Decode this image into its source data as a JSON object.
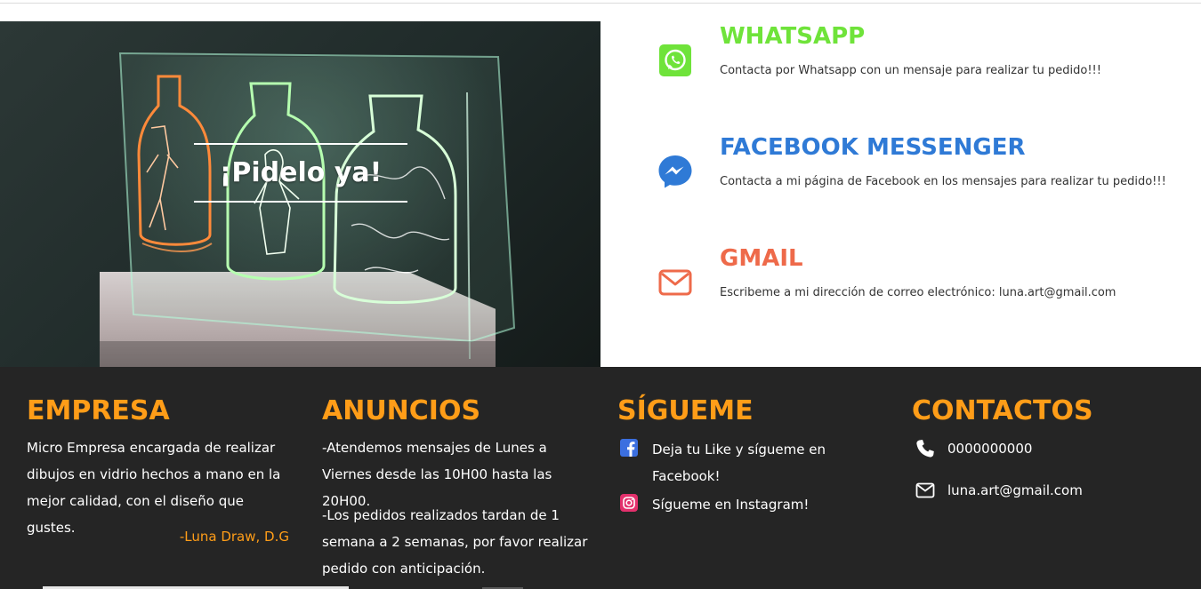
{
  "hero": {
    "title": "¡Pidelo ya!"
  },
  "methods": {
    "whatsapp": {
      "title": "WHATSAPP",
      "description": "Contacta por Whatsapp con un mensaje para realizar tu pedido!!!",
      "color": "#6fe33a",
      "icon": "whatsapp-icon"
    },
    "messenger": {
      "title": "FACEBOOK MESSENGER",
      "description": "Contacta a mi página de Facebook en los mensajes para realizar tu pedido!!!",
      "color": "#2f7ad6",
      "icon": "messenger-icon"
    },
    "gmail": {
      "title": "GMAIL",
      "description": "Escribeme a mi dirección de correo electrónico: luna.art@gmail.com",
      "color": "#ee6a4a",
      "icon": "envelope-icon"
    }
  },
  "footer": {
    "accent": "#ff9d18",
    "empresa": {
      "title": "EMPRESA",
      "text": "Micro Empresa encargada de realizar dibujos en vidrio hechos a mano en la mejor calidad, con el diseño que gustes.",
      "signature": "-Luna Draw, D.G"
    },
    "anuncios": {
      "title": "ANUNCIOS",
      "text1": "-Atendemos mensajes de Lunes a Viernes desde las 10H00 hasta las 20H00.",
      "text2": "-Los pedidos realizados tardan de 1 semana a 2 semanas, por favor realizar pedido con anticipación."
    },
    "sigueme": {
      "title": "SÍGUEME",
      "facebook": "Deja tu Like y sígueme en Facebook!",
      "instagram": "Sígueme en Instagram!"
    },
    "contactos": {
      "title": "CONTACTOS",
      "phone": "0000000000",
      "email": "luna.art@gmail.com"
    }
  }
}
